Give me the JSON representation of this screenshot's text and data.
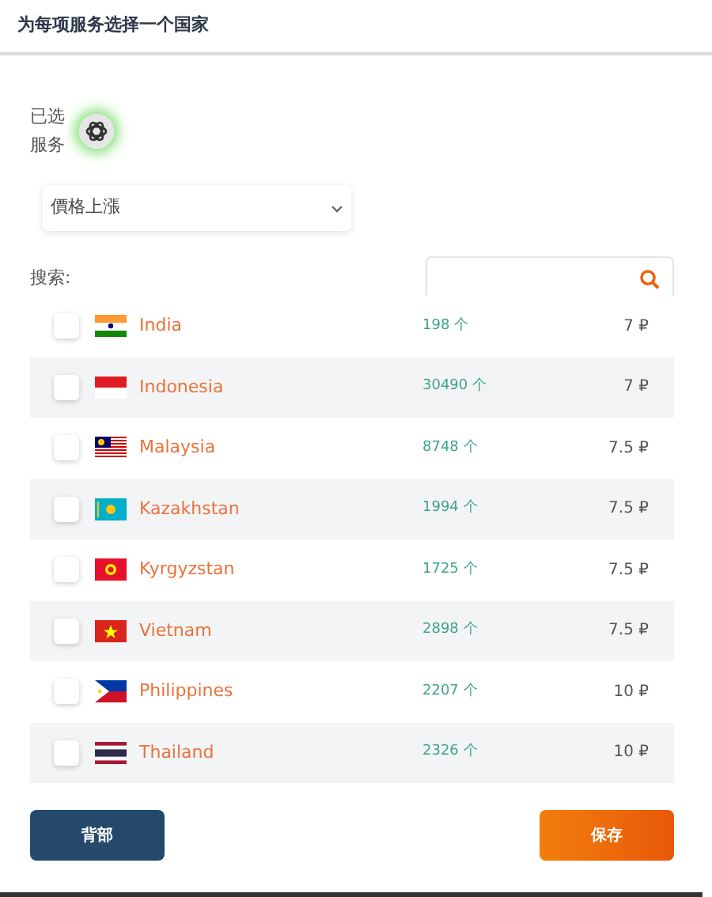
{
  "title": "为每项服务选择一个国家",
  "selected_service": {
    "label": "已选服务"
  },
  "sort_select": {
    "value": "價格上漲"
  },
  "search": {
    "label": "搜索:"
  },
  "countries": [
    {
      "name": "India",
      "kind": "india",
      "count": "198 个",
      "price": "7 ₽",
      "checked": false
    },
    {
      "name": "Indonesia",
      "kind": "indonesia",
      "count": "30490 个",
      "price": "7 ₽",
      "checked": false
    },
    {
      "name": "Malaysia",
      "kind": "malaysia",
      "count": "8748 个",
      "price": "7.5 ₽",
      "checked": false
    },
    {
      "name": "Kazakhstan",
      "kind": "kazakhstan",
      "count": "1994 个",
      "price": "7.5 ₽",
      "checked": false
    },
    {
      "name": "Kyrgyzstan",
      "kind": "kyrgyzstan",
      "count": "1725 个",
      "price": "7.5 ₽",
      "checked": false
    },
    {
      "name": "Vietnam",
      "kind": "vietnam",
      "count": "2898 个",
      "price": "7.5 ₽",
      "checked": false
    },
    {
      "name": "Philippines",
      "kind": "philippines",
      "count": "2207 个",
      "price": "10 ₽",
      "checked": false
    },
    {
      "name": "Thailand",
      "kind": "thailand",
      "count": "2326 个",
      "price": "10 ₽",
      "checked": false
    }
  ],
  "buttons": [
    {
      "label": "背部",
      "kind": "back"
    },
    {
      "label": "保存",
      "kind": "save"
    }
  ]
}
